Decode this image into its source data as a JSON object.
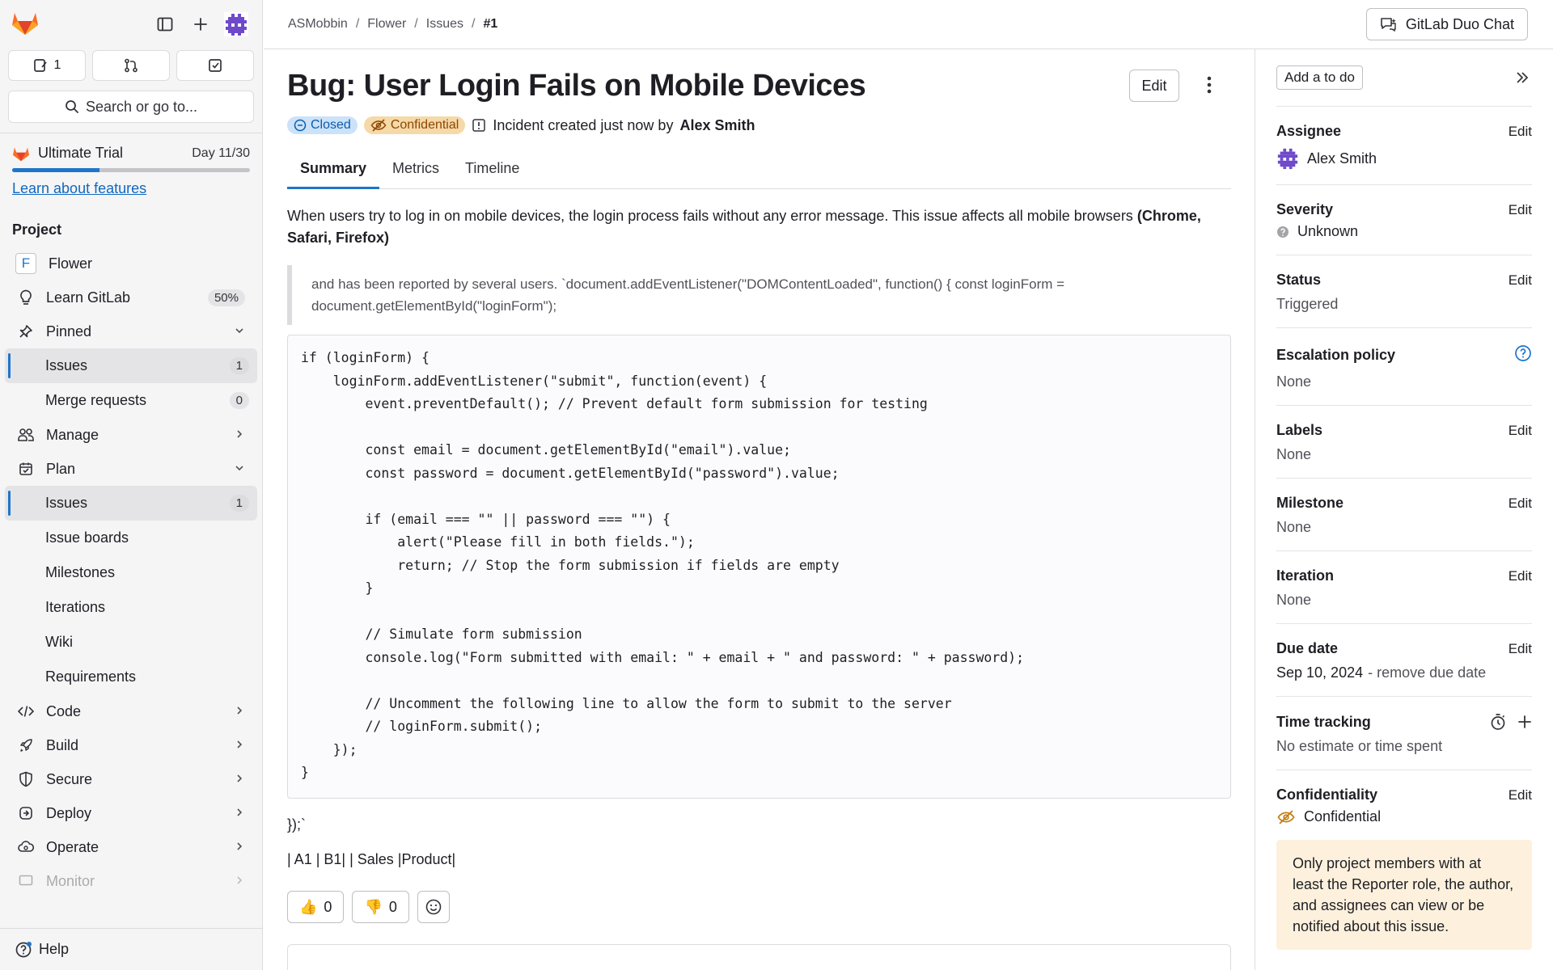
{
  "sidebar": {
    "counts": {
      "issues": "1"
    },
    "search_label": "Search or go to...",
    "trial": {
      "label": "Ultimate Trial",
      "day": "Day 11/30",
      "progress": 0.367,
      "link": "Learn about features"
    },
    "section_title": "Project",
    "project": {
      "letter": "F",
      "name": "Flower"
    },
    "learn": {
      "label": "Learn GitLab",
      "percent": "50%"
    },
    "pinned": {
      "label": "Pinned",
      "items": [
        {
          "label": "Issues",
          "count": "1"
        },
        {
          "label": "Merge requests",
          "count": "0"
        }
      ]
    },
    "manage": "Manage",
    "plan": {
      "label": "Plan",
      "issues": {
        "label": "Issues",
        "count": "1"
      },
      "items": [
        "Issue boards",
        "Milestones",
        "Iterations",
        "Wiki",
        "Requirements"
      ]
    },
    "code": "Code",
    "build": "Build",
    "secure": "Secure",
    "deploy": "Deploy",
    "operate": "Operate",
    "monitor": "Monitor",
    "help": "Help"
  },
  "header": {
    "breadcrumbs": [
      "ASMobbin",
      "Flower",
      "Issues",
      "#1"
    ],
    "duo_label": "GitLab Duo Chat"
  },
  "issue": {
    "title": "Bug: User Login Fails on Mobile Devices",
    "edit_label": "Edit",
    "status_badge": "Closed",
    "confidential_badge": "Confidential",
    "created_text": "Incident created just now by",
    "author": "Alex Smith",
    "tabs": [
      "Summary",
      "Metrics",
      "Timeline"
    ],
    "description": "When users try to log in on mobile devices, the login process fails without any error message. This issue affects all mobile browsers",
    "browsers": "(Chrome, Safari, Firefox)",
    "quote": "and has been reported by several users. `document.addEventListener(\"DOMContentLoaded\", function() { const loginForm = document.getElementById(\"loginForm\");",
    "code": "if (loginForm) {\n    loginForm.addEventListener(\"submit\", function(event) {\n        event.preventDefault(); // Prevent default form submission for testing\n\n        const email = document.getElementById(\"email\").value;\n        const password = document.getElementById(\"password\").value;\n\n        if (email === \"\" || password === \"\") {\n            alert(\"Please fill in both fields.\");\n            return; // Stop the form submission if fields are empty\n        }\n\n        // Simulate form submission\n        console.log(\"Form submitted with email: \" + email + \" and password: \" + password);\n\n        // Uncomment the following line to allow the form to submit to the server\n        // loginForm.submit();\n    });\n}",
    "after_code": "});`",
    "table_line": "| A1 | B1| | Sales |Product|",
    "thumbs_up": "0",
    "thumbs_down": "0"
  },
  "right_sidebar": {
    "todo_label": "Add a to do",
    "edit_label": "Edit",
    "assignee": {
      "title": "Assignee",
      "value": "Alex Smith"
    },
    "severity": {
      "title": "Severity",
      "value": "Unknown"
    },
    "status": {
      "title": "Status",
      "value": "Triggered"
    },
    "escalation": {
      "title": "Escalation policy",
      "value": "None"
    },
    "labels": {
      "title": "Labels",
      "value": "None"
    },
    "milestone": {
      "title": "Milestone",
      "value": "None"
    },
    "iteration": {
      "title": "Iteration",
      "value": "None"
    },
    "due_date": {
      "title": "Due date",
      "value": "Sep 10, 2024",
      "remove": "- remove due date"
    },
    "time_tracking": {
      "title": "Time tracking",
      "value": "No estimate or time spent"
    },
    "confidentiality": {
      "title": "Confidentiality",
      "value": "Confidential",
      "note": "Only project members with at least the Reporter role, the author, and assignees can view or be notified about this issue."
    }
  },
  "colors": {
    "accent": "#1f75cb",
    "brand": "#fc6d26",
    "confidential": "#f5d9a8"
  }
}
